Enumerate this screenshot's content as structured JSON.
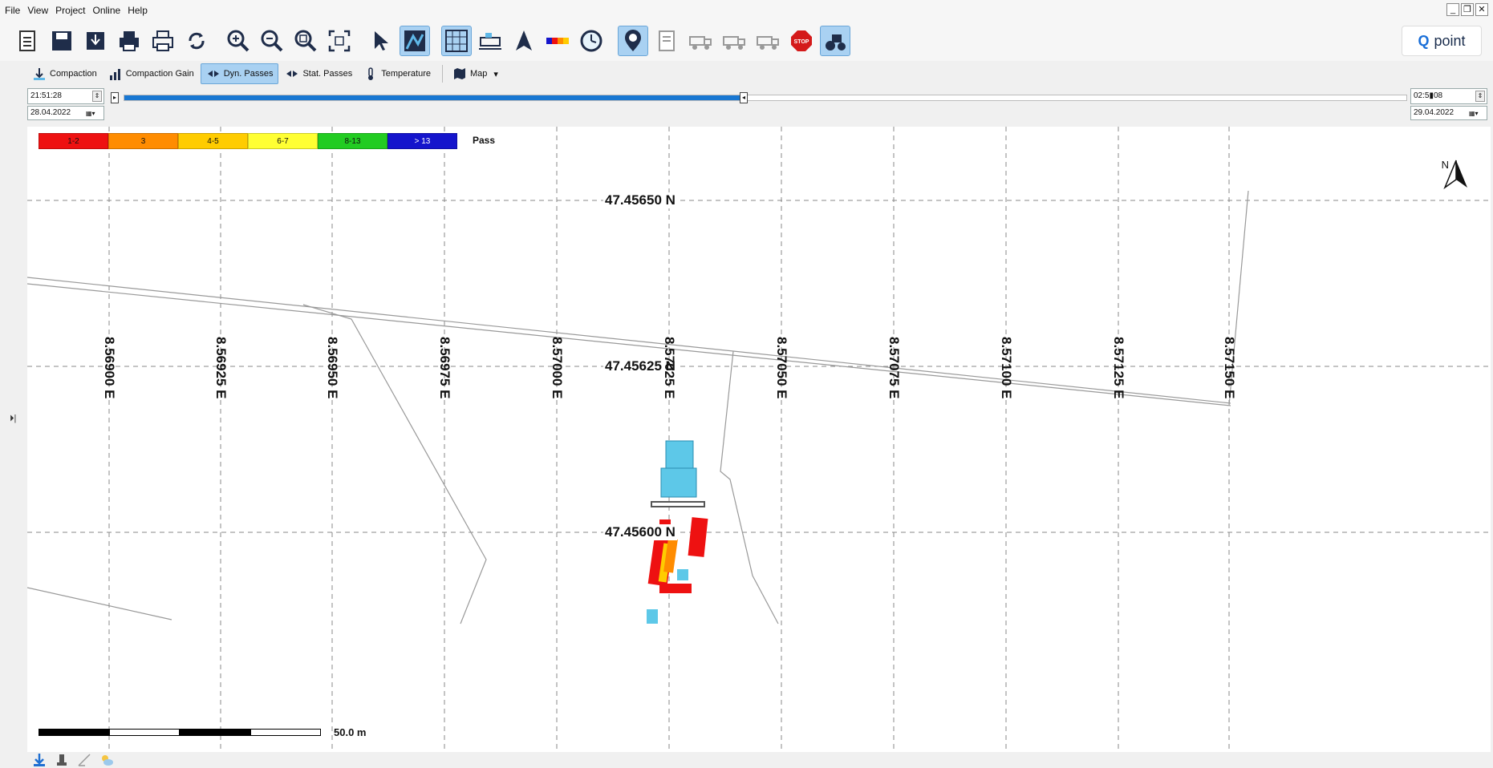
{
  "menu": [
    "File",
    "View",
    "Project",
    "Online",
    "Help"
  ],
  "window_controls": [
    "_",
    "❐",
    "✕"
  ],
  "toolbar": {
    "buttons": [
      {
        "name": "new-project-icon",
        "active": false
      },
      {
        "name": "save-icon",
        "active": false
      },
      {
        "name": "export-icon",
        "active": false
      },
      {
        "name": "print-icon",
        "active": false
      },
      {
        "name": "print-preview-icon",
        "active": false
      },
      {
        "name": "refresh-icon",
        "active": false
      },
      {
        "name": "zoom-in-icon",
        "active": false
      },
      {
        "name": "zoom-out-icon",
        "active": false
      },
      {
        "name": "zoom-area-icon",
        "active": false
      },
      {
        "name": "zoom-extent-icon",
        "active": false
      },
      {
        "name": "select-pointer-icon",
        "active": false
      },
      {
        "name": "map-view-icon",
        "active": true
      },
      {
        "name": "grid-icon",
        "active": true
      },
      {
        "name": "machine-panel-icon",
        "active": false
      },
      {
        "name": "north-icon",
        "active": false
      },
      {
        "name": "color-scale-icon",
        "active": false
      },
      {
        "name": "clock-icon",
        "active": false
      },
      {
        "name": "poi-icon",
        "active": true
      },
      {
        "name": "report-icon",
        "active": false
      },
      {
        "name": "truck-1-icon",
        "active": false
      },
      {
        "name": "truck-2-icon",
        "active": false
      },
      {
        "name": "truck-3-icon",
        "active": false
      },
      {
        "name": "stop-icon",
        "active": false
      },
      {
        "name": "roller-icon",
        "active": true
      }
    ]
  },
  "brand": {
    "q": "Q",
    "name": "point"
  },
  "view_tabs": [
    {
      "label": "Compaction",
      "active": false
    },
    {
      "label": "Compaction Gain",
      "active": false
    },
    {
      "label": "Dyn. Passes",
      "active": true
    },
    {
      "label": "Stat. Passes",
      "active": false
    },
    {
      "label": "Temperature",
      "active": false
    }
  ],
  "map_menu": {
    "label": "Map",
    "caret": "▾"
  },
  "time": {
    "start_time": "21:51:28",
    "start_date": "28.04.2022",
    "end_time": "02:5",
    "end_time_suffix": "08",
    "end_date": "29.04.2022",
    "slider_fraction": 0.48
  },
  "legend": {
    "title": "Pass",
    "entries": [
      {
        "label": "1-2",
        "color": "#ee1111"
      },
      {
        "label": "3",
        "color": "#ff8c00"
      },
      {
        "label": "4-5",
        "color": "#ffcc00"
      },
      {
        "label": "6-7",
        "color": "#ffff33"
      },
      {
        "label": "8-13",
        "color": "#22cc22"
      },
      {
        "label": "> 13",
        "color": "#1515cc"
      }
    ]
  },
  "lat_labels": [
    "47.45650 N",
    "47.45625 N",
    "47.45600 N"
  ],
  "lon_labels": [
    "8.56900 E",
    "8.56925 E",
    "8.56950 E",
    "8.56975 E",
    "8.57000 E",
    "8.57025 E",
    "8.57050 E",
    "8.57075 E",
    "8.57100 E",
    "8.57125 E",
    "8.57150 E"
  ],
  "north": "N",
  "scale": {
    "label": "50.0 m"
  },
  "rail_toggle": "⏵|",
  "bottom_icons": [
    "compaction-icon",
    "machine-icon",
    "measure-icon",
    "weather-icon"
  ]
}
